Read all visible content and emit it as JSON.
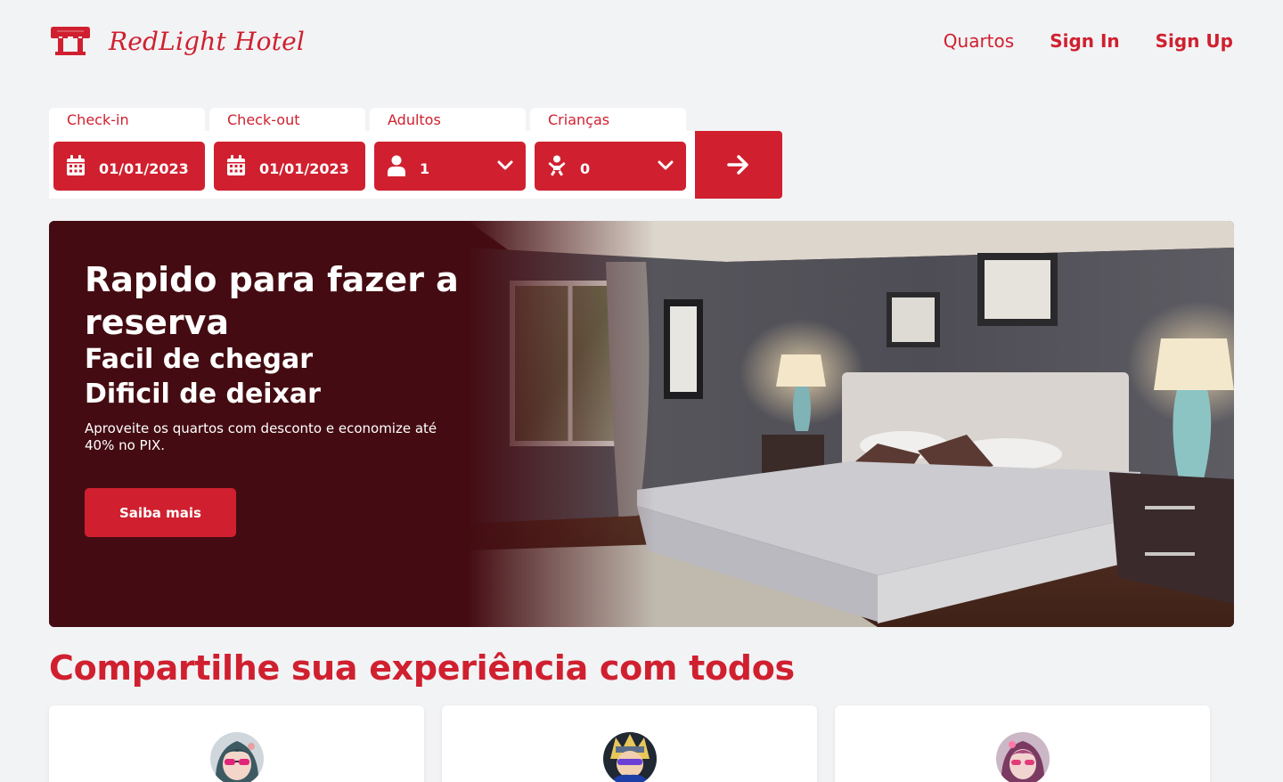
{
  "brand": {
    "name": "RedLight Hotel",
    "icon": "hotel-awning-icon",
    "color": "#d0202f"
  },
  "nav": {
    "rooms": "Quartos",
    "sign_in": "Sign In",
    "sign_up": "Sign Up"
  },
  "booking": {
    "checkin": {
      "label": "Check-in",
      "value": "01/01/2023",
      "icon": "calendar-icon"
    },
    "checkout": {
      "label": "Check-out",
      "value": "01/01/2023",
      "icon": "calendar-icon"
    },
    "adults": {
      "label": "Adultos",
      "value": "1",
      "icon": "person-icon"
    },
    "children": {
      "label": "Crianças",
      "value": "0",
      "icon": "baby-icon"
    },
    "submit_icon": "arrow-right-icon"
  },
  "hero": {
    "title": "Rapido para fazer a reserva",
    "subtitle_line1": "Facil de chegar",
    "subtitle_line2": "Dificil de deixar",
    "description": "Aproveite os quartos com desconto e economize até 40% no PIX.",
    "cta": "Saiba mais",
    "overlay_color": "#440c12"
  },
  "testimonials": {
    "title": "Compartilhe sua experiência com todos",
    "cards": [
      {
        "avatar": "avatar-anime-girl-sunglasses"
      },
      {
        "avatar": "avatar-anime-boy-headband"
      },
      {
        "avatar": "avatar-anime-girl-pink"
      }
    ]
  }
}
